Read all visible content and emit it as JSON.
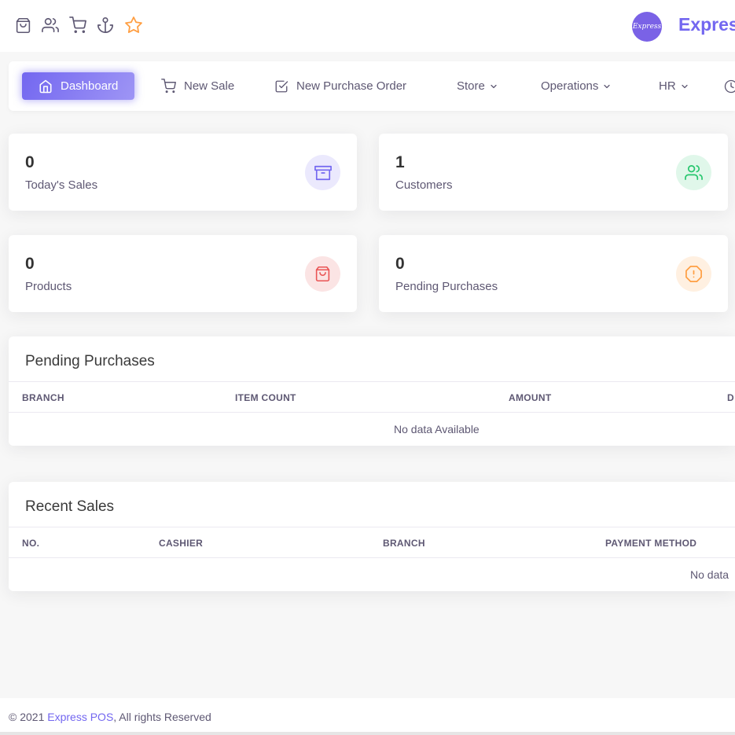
{
  "topbar": {
    "icons": [
      "shopping-bag-icon",
      "users-icon",
      "shopping-cart-icon",
      "anchor-icon",
      "star-icon"
    ],
    "logo_text": "Express",
    "brand_name": "Express"
  },
  "nav": {
    "items": [
      {
        "label": "Dashboard",
        "icon": "home-icon",
        "active": true
      },
      {
        "label": "New Sale",
        "icon": "shopping-cart-icon"
      },
      {
        "label": "New Purchase Order",
        "icon": "check-square-icon"
      },
      {
        "label": "Store",
        "icon": "chevron-down-icon"
      },
      {
        "label": "Operations",
        "icon": "chevron-down-icon"
      },
      {
        "label": "HR",
        "icon": "chevron-down-icon"
      }
    ]
  },
  "stats": [
    {
      "value": "0",
      "label": "Today's Sales",
      "icon": "archive-icon",
      "color": "#7367f0",
      "bg": "#ebe9fd"
    },
    {
      "value": "1",
      "label": "Customers",
      "icon": "users-icon",
      "color": "#28c76f",
      "bg": "#e0f7ea"
    },
    {
      "value": "0",
      "label": "Products",
      "icon": "shopping-bag-icon",
      "color": "#ea5455",
      "bg": "#fbe4e4"
    },
    {
      "value": "0",
      "label": "Pending Purchases",
      "icon": "alert-octagon-icon",
      "color": "#ff9f43",
      "bg": "#fff0e1"
    }
  ],
  "pending_purchases": {
    "title": "Pending Purchases",
    "columns": [
      "BRANCH",
      "ITEM COUNT",
      "AMOUNT",
      "D"
    ],
    "empty_text": "No data Available"
  },
  "recent_sales": {
    "title": "Recent Sales",
    "columns": [
      "NO.",
      "CASHIER",
      "BRANCH",
      "PAYMENT METHOD"
    ],
    "empty_text": "No data"
  },
  "footer": {
    "prefix": "© 2021 ",
    "link": "Express POS",
    "suffix": ", All rights Reserved"
  }
}
